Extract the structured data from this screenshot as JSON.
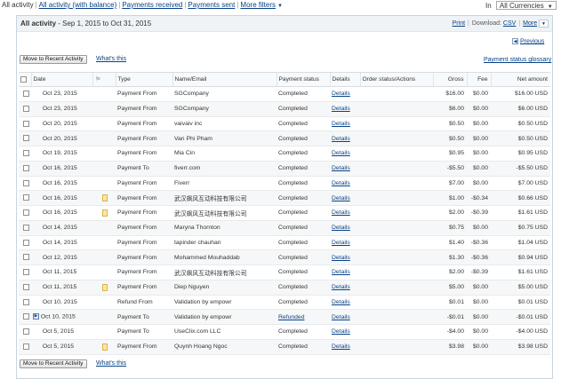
{
  "topnav": {
    "tabs": [
      {
        "label": "All activity",
        "active": true
      },
      {
        "label": "All activity (with balance)",
        "active": false
      },
      {
        "label": "Payments received",
        "active": false
      },
      {
        "label": "Payments sent",
        "active": false
      },
      {
        "label": "More filters",
        "active": false
      }
    ],
    "currency_prefix": "In",
    "currency_value": "All Currencies"
  },
  "header": {
    "title": "All activity",
    "date_range": " - Sep 1, 2015 to Oct 31, 2015",
    "print": "Print",
    "download_label": "Download:",
    "csv": "CSV",
    "more": "More"
  },
  "prev_link": "Previous",
  "move_button": "Move to Recent Activity",
  "whats_this": "What's this",
  "glossary": "Payment status glossary",
  "columns": [
    "Date",
    "Type",
    "Name/Email",
    "Payment status",
    "Details",
    "Order status/Actions",
    "Gross",
    "Fee",
    "Net amount"
  ],
  "rows": [
    {
      "date": "Oct 23, 2015",
      "type": "Payment From",
      "name": "SGCompany",
      "status": "Completed",
      "details": "Details",
      "gross": "$16.00",
      "fee": "$0.00",
      "net": "$16.00 USD"
    },
    {
      "date": "Oct 23, 2015",
      "type": "Payment From",
      "name": "SGCompany",
      "status": "Completed",
      "details": "Details",
      "gross": "$6.00",
      "fee": "$0.00",
      "net": "$6.00 USD"
    },
    {
      "date": "Oct 20, 2015",
      "type": "Payment From",
      "name": "vaivaiv inc",
      "status": "Completed",
      "details": "Details",
      "gross": "$0.50",
      "fee": "$0.00",
      "net": "$0.50 USD"
    },
    {
      "date": "Oct 20, 2015",
      "type": "Payment From",
      "name": "Van Phi Pham",
      "status": "Completed",
      "details": "Details",
      "gross": "$0.50",
      "fee": "$0.00",
      "net": "$0.50 USD"
    },
    {
      "date": "Oct 19, 2015",
      "type": "Payment From",
      "name": "Mia Cin",
      "status": "Completed",
      "details": "Details",
      "gross": "$0.95",
      "fee": "$0.00",
      "net": "$0.95 USD"
    },
    {
      "date": "Oct 16, 2015",
      "type": "Payment To",
      "name": "fiverr.com",
      "status": "Completed",
      "details": "Details",
      "gross": "-$5.50",
      "fee": "$0.00",
      "net": "-$5.50 USD"
    },
    {
      "date": "Oct 16, 2015",
      "type": "Payment From",
      "name": "Fiverr",
      "status": "Completed",
      "details": "Details",
      "gross": "$7.00",
      "fee": "$0.00",
      "net": "$7.00 USD"
    },
    {
      "date": "Oct 16, 2015",
      "note": true,
      "type": "Payment From",
      "name": "武汉飙风互动科技有限公司",
      "status": "Completed",
      "details": "Details",
      "gross": "$1.00",
      "fee": "-$0.34",
      "net": "$0.66 USD"
    },
    {
      "date": "Oct 16, 2015",
      "note": true,
      "type": "Payment From",
      "name": "武汉飙风互动科技有限公司",
      "status": "Completed",
      "details": "Details",
      "gross": "$2.00",
      "fee": "-$0.39",
      "net": "$1.61 USD"
    },
    {
      "date": "Oct 14, 2015",
      "type": "Payment From",
      "name": "Maryna Thornton",
      "status": "Completed",
      "details": "Details",
      "gross": "$0.75",
      "fee": "$0.00",
      "net": "$0.75 USD"
    },
    {
      "date": "Oct 14, 2015",
      "type": "Payment From",
      "name": "tapinder chauhan",
      "status": "Completed",
      "details": "Details",
      "gross": "$1.40",
      "fee": "-$0.36",
      "net": "$1.04 USD"
    },
    {
      "date": "Oct 12, 2015",
      "type": "Payment From",
      "name": "Mohammed Mouhaddab",
      "status": "Completed",
      "details": "Details",
      "gross": "$1.30",
      "fee": "-$0.36",
      "net": "$0.94 USD"
    },
    {
      "date": "Oct 11, 2015",
      "type": "Payment From",
      "name": "武汉飙风互动科技有限公司",
      "status": "Completed",
      "details": "Details",
      "gross": "$2.00",
      "fee": "-$0.39",
      "net": "$1.61 USD"
    },
    {
      "date": "Oct 11, 2015",
      "note": true,
      "type": "Payment From",
      "name": "Diep Nguyen",
      "status": "Completed",
      "details": "Details",
      "gross": "$5.00",
      "fee": "$0.00",
      "net": "$5.00 USD"
    },
    {
      "date": "Oct 10, 2015",
      "type": "Refund From",
      "name": "Validation by empowr",
      "status": "Completed",
      "details": "Details",
      "gross": "$0.01",
      "fee": "$0.00",
      "net": "$0.01 USD"
    },
    {
      "date": "Oct 10, 2015",
      "expand": true,
      "type": "Payment To",
      "name": "Validation by empowr",
      "status": "Refunded",
      "status_link": true,
      "details": "Details",
      "gross": "-$0.01",
      "fee": "$0.00",
      "net": "-$0.01 USD"
    },
    {
      "date": "Oct 5, 2015",
      "type": "Payment To",
      "name": "UseClix.com LLC",
      "status": "Completed",
      "details": "Details",
      "gross": "-$4.00",
      "fee": "$0.00",
      "net": "-$4.00 USD"
    },
    {
      "date": "Oct 5, 2015",
      "note": true,
      "type": "Payment From",
      "name": "Quynh Hoang Ngoc",
      "status": "Completed",
      "details": "Details",
      "gross": "$3.98",
      "fee": "$0.00",
      "net": "$3.98 USD"
    }
  ]
}
